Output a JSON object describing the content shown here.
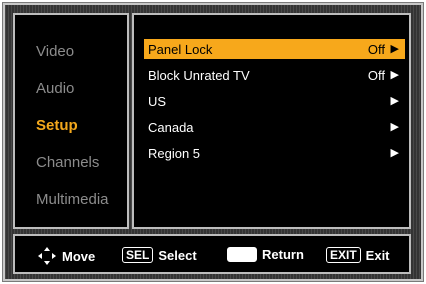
{
  "sidebar": {
    "items": [
      {
        "label": "Video"
      },
      {
        "label": "Audio"
      },
      {
        "label": "Setup",
        "active": true
      },
      {
        "label": "Channels"
      },
      {
        "label": "Multimedia"
      }
    ]
  },
  "menu": {
    "items": [
      {
        "label": "Panel Lock",
        "value": "Off",
        "arrow": "▶",
        "selected": true
      },
      {
        "label": "Block Unrated TV",
        "value": "Off",
        "arrow": "▶"
      },
      {
        "label": "US",
        "value": "",
        "arrow": "▶"
      },
      {
        "label": "Canada",
        "value": "",
        "arrow": "▶"
      },
      {
        "label": "Region 5",
        "value": "",
        "arrow": "▶"
      }
    ]
  },
  "help_bar": {
    "move_label": "Move",
    "sel_key": "SEL",
    "select_label": "Select",
    "return_label": "Return",
    "exit_key": "EXIT",
    "exit_label": "Exit"
  },
  "colors": {
    "accent": "#f7a81b",
    "inactive_text": "#8c8c8c",
    "background": "#000000"
  }
}
